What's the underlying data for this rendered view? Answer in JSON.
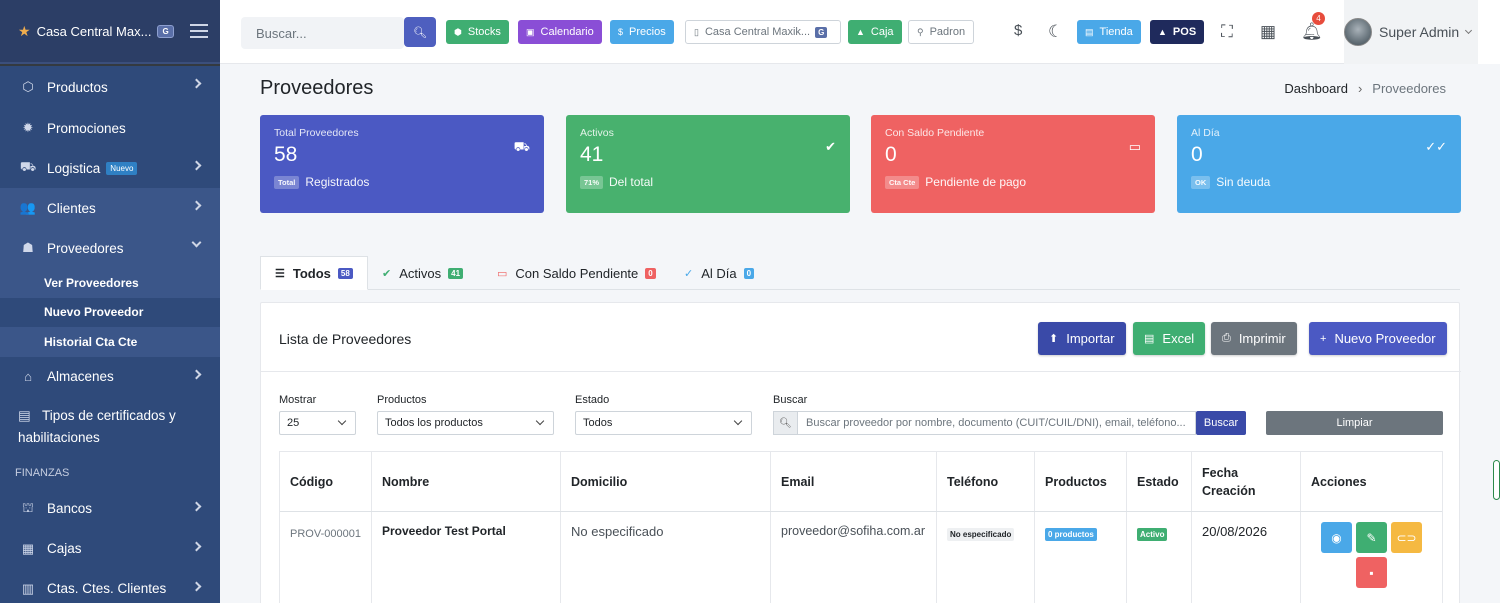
{
  "brand": {
    "name": "Casa Central Max...",
    "badge": "G"
  },
  "sidebar": {
    "items": [
      {
        "label": "Productos",
        "icon": "box-icon"
      },
      {
        "label": "Promociones",
        "icon": "gear-icon"
      },
      {
        "label": "Logistica",
        "badge": "Nuevo",
        "icon": "truck-icon"
      },
      {
        "label": "Clientes",
        "icon": "users-icon"
      },
      {
        "label": "Proveedores",
        "icon": "people-carry-icon"
      }
    ],
    "sub": [
      "Ver Proveedores",
      "Nuevo Proveedor",
      "Historial Cta Cte"
    ],
    "items2": [
      {
        "label": "Almacenes",
        "icon": "warehouse-icon"
      }
    ],
    "multi": "Tipos de certificados y habilitaciones",
    "section": "FINANZAS",
    "items3": [
      {
        "label": "Bancos",
        "icon": "bank-icon"
      },
      {
        "label": "Cajas",
        "icon": "cash-register-icon"
      },
      {
        "label": "Ctas. Ctes. Clientes",
        "icon": "ledger-icon"
      }
    ]
  },
  "topbar": {
    "search_placeholder": "Buscar...",
    "buttons": {
      "stocks": "Stocks",
      "calendario": "Calendario",
      "precios": "Precios",
      "sucursal": "Casa Central Maxik...",
      "sucursal_badge": "G",
      "caja": "Caja",
      "padron": "Padron",
      "tienda": "Tienda",
      "pos": "POS"
    },
    "notifications": "4",
    "user": "Super Admin"
  },
  "page": {
    "title": "Proveedores",
    "breadcrumb": [
      "Dashboard",
      "Proveedores"
    ]
  },
  "cards": [
    {
      "label": "Total Proveedores",
      "value": "58",
      "badge": "Total",
      "sub": "Registrados",
      "color": "#4b59c3"
    },
    {
      "label": "Activos",
      "value": "41",
      "badge": "71%",
      "sub": "Del total",
      "color": "#48b16e"
    },
    {
      "label": "Con Saldo Pendiente",
      "value": "0",
      "badge": "Cta Cte",
      "sub": "Pendiente de pago",
      "color": "#ef6262"
    },
    {
      "label": "Al Día",
      "value": "0",
      "badge": "OK",
      "sub": "Sin deuda",
      "color": "#4aa8e8"
    }
  ],
  "tabs": [
    {
      "label": "Todos",
      "count": "58"
    },
    {
      "label": "Activos",
      "count": "41"
    },
    {
      "label": "Con Saldo Pendiente",
      "count": "0"
    },
    {
      "label": "Al Día",
      "count": "0"
    }
  ],
  "panel": {
    "title": "Lista de Proveedores",
    "actions": {
      "importar": "Importar",
      "excel": "Excel",
      "imprimir": "Imprimir",
      "nuevo": "Nuevo Proveedor"
    },
    "filters": {
      "mostrar_label": "Mostrar",
      "mostrar_value": "25",
      "productos_label": "Productos",
      "productos_value": "Todos los productos",
      "estado_label": "Estado",
      "estado_value": "Todos",
      "buscar_label": "Buscar",
      "buscar_placeholder": "Buscar proveedor por nombre, documento (CUIT/CUIL/DNI), email, teléfono...",
      "buscar_btn": "Buscar",
      "limpiar_btn": "Limpiar"
    },
    "table": {
      "headers": [
        "Código",
        "Nombre",
        "Domicilio",
        "Email",
        "Teléfono",
        "Productos",
        "Estado",
        "Fecha Creación",
        "Acciones"
      ],
      "rows": [
        {
          "codigo": "PROV-000001",
          "nombre": "Proveedor Test Portal",
          "domicilio": "No especificado",
          "email": "proveedor@sofiha.com.ar",
          "telefono": "No especificado",
          "productos": "0 productos",
          "estado": "Activo",
          "fecha": "20/08/2026"
        }
      ]
    }
  }
}
